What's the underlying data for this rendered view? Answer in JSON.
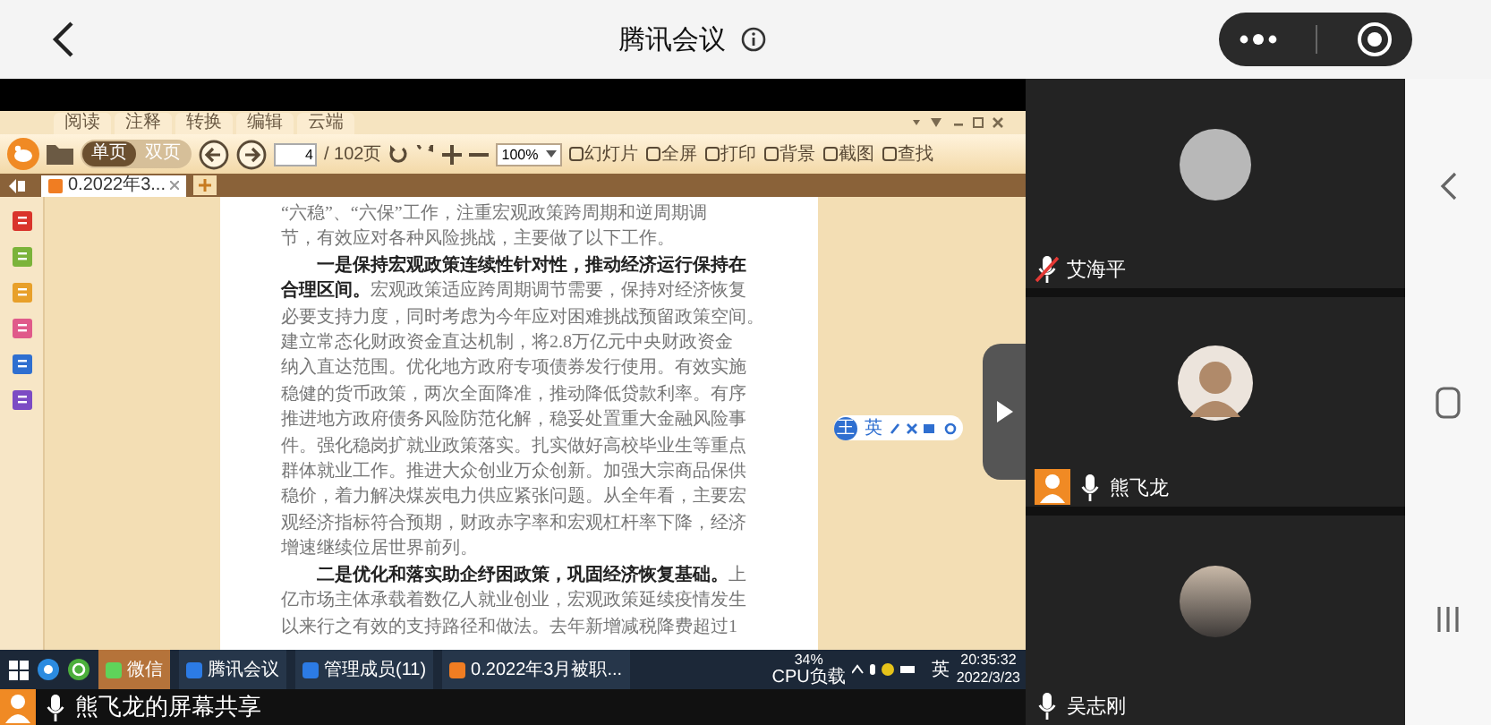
{
  "header": {
    "title": "腾讯会议"
  },
  "reader": {
    "menu_tabs": [
      "阅读",
      "注释",
      "转换",
      "编辑",
      "云端"
    ],
    "view_modes": [
      {
        "label": "单页",
        "selected": true
      },
      {
        "label": "双页",
        "selected": false
      }
    ],
    "page_input": "4",
    "page_total": "/ 102页",
    "zoom": "100%",
    "tools": [
      "幻灯片",
      "全屏",
      "打印",
      "背景",
      "截图",
      "查找"
    ],
    "document_tab": "0.2022年3...",
    "ime_bar": {
      "logo": "王",
      "mode": "英"
    },
    "document_lines": [
      {
        "text": "“六稳”、“六保”工作，注重宏观政策跨周期和逆周期调",
        "indent": false,
        "bold": false
      },
      {
        "text": "节，有效应对各种风险挑战，主要做了以下工作。",
        "indent": false,
        "bold": false
      },
      {
        "text": "一是保持宏观政策连续性针对性，推动经济运行保持在",
        "indent": true,
        "bold": true
      },
      {
        "text": "**合理区间。**宏观政策适应跨周期调节需要，保持对经济恢复",
        "indent": false,
        "bold": false
      },
      {
        "text": "必要支持力度，同时考虑为今年应对困难挑战预留政策空间。",
        "indent": false,
        "bold": false
      },
      {
        "text": "建立常态化财政资金直达机制，将2.8万亿元中央财政资金",
        "indent": false,
        "bold": false
      },
      {
        "text": "纳入直达范围。优化地方政府专项债券发行使用。有效实施",
        "indent": false,
        "bold": false
      },
      {
        "text": "稳健的货币政策，两次全面降准，推动降低贷款利率。有序",
        "indent": false,
        "bold": false
      },
      {
        "text": "推进地方政府债务风险防范化解，稳妥处置重大金融风险事",
        "indent": false,
        "bold": false
      },
      {
        "text": "件。强化稳岗扩就业政策落实。扎实做好高校毕业生等重点",
        "indent": false,
        "bold": false
      },
      {
        "text": "群体就业工作。推进大众创业万众创新。加强大宗商品保供",
        "indent": false,
        "bold": false
      },
      {
        "text": "稳价，着力解决煤炭电力供应紧张问题。从全年看，主要宏",
        "indent": false,
        "bold": false
      },
      {
        "text": "观经济指标符合预期，财政赤字率和宏观杠杆率下降，经济",
        "indent": false,
        "bold": false
      },
      {
        "text": "增速继续位居世界前列。",
        "indent": false,
        "bold": false
      },
      {
        "text": "**二是优化和落实助企纾困政策，巩固经济恢复基础。**上",
        "indent": true,
        "bold": false
      },
      {
        "text": "亿市场主体承载着数亿人就业创业，宏观政策延续疫情发生",
        "indent": false,
        "bold": false
      },
      {
        "text": "以来行之有效的支持路径和做法。去年新增减税降费超过1",
        "indent": false,
        "bold": false
      }
    ]
  },
  "taskbar": {
    "apps": [
      {
        "label": "微信",
        "selected": true
      },
      {
        "label": "腾讯会议",
        "selected": false
      },
      {
        "label": "管理成员(11)",
        "selected": false
      },
      {
        "label": "0.2022年3月被职...",
        "selected": false
      }
    ],
    "cpu": "34%",
    "cpu_label": "CPU负载",
    "ime": "英",
    "time": "20:35:32",
    "date": "2022/3/23"
  },
  "presenter_bar": {
    "label": "熊飞龙的屏幕共享"
  },
  "participants": [
    {
      "name": "艾海平",
      "muted": true,
      "sharing": false,
      "kind": "photo"
    },
    {
      "name": "熊飞龙",
      "muted": false,
      "sharing": true,
      "kind": "cartoon"
    },
    {
      "name": "吴志刚",
      "muted": false,
      "sharing": false,
      "kind": "sunset"
    }
  ]
}
